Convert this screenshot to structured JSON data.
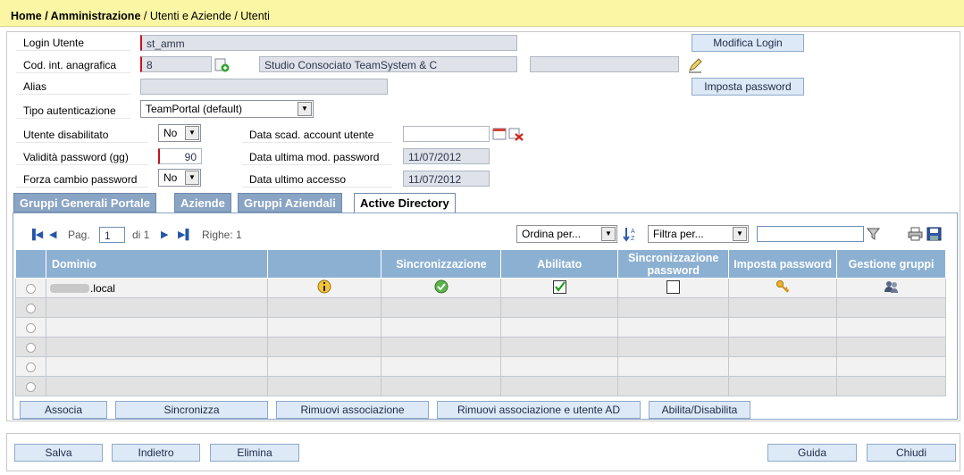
{
  "breadcrumb": {
    "part1": "Home / Amministrazione",
    "part2": " / Utenti e Aziende / Utenti"
  },
  "form": {
    "login_label": "Login Utente",
    "login_value": "st_amm",
    "cod_label": "Cod. int. anagrafica",
    "cod_value": "8",
    "company_value": "Studio Consociato TeamSystem & C",
    "company_extra": "",
    "alias_label": "Alias",
    "alias_value": "",
    "auth_label": "Tipo autenticazione",
    "auth_value": "TeamPortal (default)",
    "disabled_label": "Utente disabilitato",
    "disabled_value": "No",
    "validity_label": "Validità password (gg)",
    "validity_value": "90",
    "force_label": "Forza cambio password",
    "force_value": "No",
    "expiry_label": "Data scad. account utente",
    "expiry_value": "",
    "lastmod_label": "Data ultima mod. password",
    "lastmod_value": "11/07/2012",
    "lastaccess_label": "Data ultimo accesso",
    "lastaccess_value": "11/07/2012",
    "modify_login_btn": "Modifica Login",
    "set_password_btn": "Imposta password"
  },
  "tabs": [
    "Gruppi Generali Portale",
    "Aziende",
    "Gruppi Aziendali",
    "Active Directory"
  ],
  "pager": {
    "page_label": "Pag.",
    "page_value": "1",
    "of": "di 1",
    "rows": "Righe: 1",
    "sort": "Ordina per...",
    "filter": "Filtra per...",
    "filter_text": ""
  },
  "table": {
    "headers": [
      "Dominio",
      "",
      "Sincronizzazione",
      "Abilitato",
      "Sincronizzazione password",
      "Imposta password",
      "Gestione gruppi"
    ],
    "row1_domain": ".local"
  },
  "actions": [
    "Associa",
    "Sincronizza",
    "Rimuovi associazione",
    "Rimuovi associazione e utente AD",
    "Abilita/Disabilita"
  ],
  "footer": {
    "save": "Salva",
    "back": "Indietro",
    "delete": "Elimina",
    "help": "Guida",
    "close": "Chiudi"
  }
}
